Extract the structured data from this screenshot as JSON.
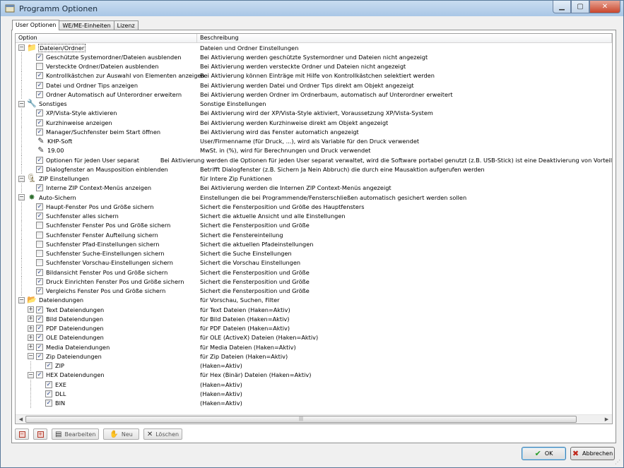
{
  "window": {
    "title": "Programm Optionen"
  },
  "tabs": [
    {
      "label": "User Optionen",
      "active": true
    },
    {
      "label": "WE/ME-Einheiten",
      "active": false
    },
    {
      "label": "Lizenz",
      "active": false
    }
  ],
  "columns": {
    "option": "Option",
    "description": "Beschreibung"
  },
  "rows": [
    {
      "level": 0,
      "expander": "−",
      "icon": "folder-tree-icon",
      "glyph": "📁",
      "label": "Dateien/Ordner",
      "desc": "Dateien und Ordner Einstellungen"
    },
    {
      "level": 1,
      "checkbox": true,
      "label": "Geschützte Systemordner/Dateien ausblenden",
      "desc": "Bei Aktivierung werden geschützte Systemordner und Dateien nicht angezeigt"
    },
    {
      "level": 1,
      "checkbox": false,
      "label": "Versteckte Ordner/Dateien ausblenden",
      "desc": "Bei Aktivierung werden versteckte Ordner und Dateien nicht angezeigt"
    },
    {
      "level": 1,
      "checkbox": true,
      "label": "Kontrollkästchen zur Auswahl von Elementen anzeigen",
      "desc": "Bei Aktivierung können Einträge mit Hilfe von Kontrollkästchen selektiert werden"
    },
    {
      "level": 1,
      "checkbox": true,
      "label": "Datei und Ordner Tips anzeigen",
      "desc": "Bei Aktivierung werden Datei und Ordner Tips direkt am Objekt angezeigt"
    },
    {
      "level": 1,
      "checkbox": true,
      "label": "Ordner Automatisch auf Unterordner erweitern",
      "desc": "Bei Aktivierung werden Ordner im Ordnerbaum, automatisch auf Unterordner erweitert"
    },
    {
      "level": 0,
      "expander": "−",
      "icon": "tools-icon",
      "glyph": "🔧",
      "label": "Sonstiges",
      "desc": "Sonstige Einstellungen"
    },
    {
      "level": 1,
      "checkbox": true,
      "label": "XP/Vista-Style aktivieren",
      "desc": "Bei Aktivierung wird der XP/Vista-Style aktiviert, Voraussetzung XP/Vista-System"
    },
    {
      "level": 1,
      "checkbox": true,
      "label": "Kurzhinweise anzeigen",
      "desc": "Bei Aktivierung werden Kurzhinweise direkt am Objekt angezeigt"
    },
    {
      "level": 1,
      "checkbox": true,
      "label": "Manager/Suchfenster beim Start öffnen",
      "desc": "Bei Aktivierung wird das Fenster automatich angezeigt"
    },
    {
      "level": 1,
      "icon": "edit-field-icon",
      "glyph": "✎",
      "label": "KHP-Soft",
      "desc": "User/Firmenname (für Druck, ...), wird als Variable für den Druck verwendet"
    },
    {
      "level": 1,
      "icon": "edit-field-icon",
      "glyph": "✎",
      "label": "19.00",
      "desc": "MwSt. in (%), wird für Berechnungen und Druck verwendet"
    },
    {
      "level": 1,
      "checkbox": true,
      "label": "Optionen für jeden User separat",
      "desc": "Bei Aktivierung werden die Optionen für jeden User separat verwaltet, wird die Software portabel genutzt (z.B. USB-Stick) ist eine Deaktivierung von Vorteil"
    },
    {
      "level": 1,
      "checkbox": true,
      "label": "Dialogfenster an Mausposition einblenden",
      "desc": "Betrifft Dialogfenster (z.B. Sichern Ja Nein Abbruch) die durch eine Mausaktion aufgerufen werden"
    },
    {
      "level": 0,
      "expander": "−",
      "icon": "zip-icon",
      "glyph": "🗜",
      "label": "ZIP Einstellungen",
      "desc": "für Intere Zip Funktionen"
    },
    {
      "level": 1,
      "checkbox": true,
      "label": "Interne ZIP Context-Menüs anzeigen",
      "desc": "Bei Aktivierung werden die Internen ZIP Context-Menüs angezeigt"
    },
    {
      "level": 0,
      "expander": "−",
      "icon": "autosave-icon",
      "glyph": "✸",
      "label": "Auto-Sichern",
      "desc": "Einstellungen die bei Programmende/Fensterschließen automatisch gesichert werden sollen"
    },
    {
      "level": 1,
      "checkbox": true,
      "label": "Haupt-Fenster Pos und Größe sichern",
      "desc": "Sichert die Fensterposition und Größe des Hauptfensters"
    },
    {
      "level": 1,
      "checkbox": true,
      "label": "Suchfenster alles sichern",
      "desc": "Sichert die aktuelle Ansicht und alle Einstellungen"
    },
    {
      "level": 1,
      "checkbox": false,
      "label": "Suchfenster Fenster Pos und Größe sichern",
      "desc": "Sichert die Fensterposition und Größe"
    },
    {
      "level": 1,
      "checkbox": false,
      "label": "Suchfenster Fenster Aufteilung sichern",
      "desc": "Sichert die Fenstereinteilung"
    },
    {
      "level": 1,
      "checkbox": false,
      "label": "Suchfenster Pfad-Einstellungen sichern",
      "desc": "Sichert die aktuellen Pfadeinstellungen"
    },
    {
      "level": 1,
      "checkbox": false,
      "label": "Suchfenster Suche-Einstellungen sichern",
      "desc": "Sichert die Suche Einstellungen"
    },
    {
      "level": 1,
      "checkbox": false,
      "label": "Suchfenster Vorschau-Einstellungen sichern",
      "desc": "Sichert die Vorschau Einstellungen"
    },
    {
      "level": 1,
      "checkbox": true,
      "label": "Bildansicht Fenster Pos und Größe sichern",
      "desc": "Sichert die Fensterposition und Größe"
    },
    {
      "level": 1,
      "checkbox": true,
      "label": "Druck Einrichten Fenster Pos und Größe sichern",
      "desc": "Sichert die Fensterposition und Größe"
    },
    {
      "level": 1,
      "checkbox": true,
      "label": "Vergleichs Fenster Pos und Größe sichern",
      "desc": "Sichert die Fensterposition und Größe"
    },
    {
      "level": 0,
      "expander": "−",
      "icon": "file-types-icon",
      "glyph": "📂",
      "label": "Dateiendungen",
      "desc": "für Vorschau, Suchen, Filter"
    },
    {
      "level": 1,
      "expander": "+",
      "checkbox": true,
      "label": "Text Dateiendungen",
      "desc": "für Text Dateien (Haken=Aktiv)"
    },
    {
      "level": 1,
      "expander": "+",
      "checkbox": true,
      "label": "Bild Dateiendungen",
      "desc": "für Bild Dateien (Haken=Aktiv)"
    },
    {
      "level": 1,
      "expander": "+",
      "checkbox": true,
      "label": "PDF Dateiendungen",
      "desc": "für PDF Dateien (Haken=Aktiv)"
    },
    {
      "level": 1,
      "expander": "+",
      "checkbox": true,
      "label": "OLE Dateiendungen",
      "desc": "für OLE (ActiveX) Dateien (Haken=Aktiv)"
    },
    {
      "level": 1,
      "expander": "+",
      "checkbox": true,
      "label": "Media Dateiendungen",
      "desc": "für Media Dateien (Haken=Aktiv)"
    },
    {
      "level": 1,
      "expander": "−",
      "checkbox": true,
      "label": "Zip Dateiendungen",
      "desc": "für Zip Dateien (Haken=Aktiv)"
    },
    {
      "level": 2,
      "checkbox": true,
      "label": "ZIP",
      "desc": "(Haken=Aktiv)"
    },
    {
      "level": 1,
      "expander": "−",
      "checkbox": true,
      "label": "HEX Dateiendungen",
      "desc": "für Hex (Binär) Dateien (Haken=Aktiv)"
    },
    {
      "level": 2,
      "checkbox": true,
      "label": "EXE",
      "desc": "(Haken=Aktiv)"
    },
    {
      "level": 2,
      "checkbox": true,
      "label": "DLL",
      "desc": "(Haken=Aktiv)"
    },
    {
      "level": 2,
      "checkbox": true,
      "label": "BIN",
      "desc": "(Haken=Aktiv)"
    }
  ],
  "toolbar": {
    "edit_label": "Bearbeiten",
    "new_label": "Neu",
    "delete_label": "Löschen"
  },
  "footer": {
    "ok_label": "OK",
    "cancel_label": "Abbrechen"
  }
}
